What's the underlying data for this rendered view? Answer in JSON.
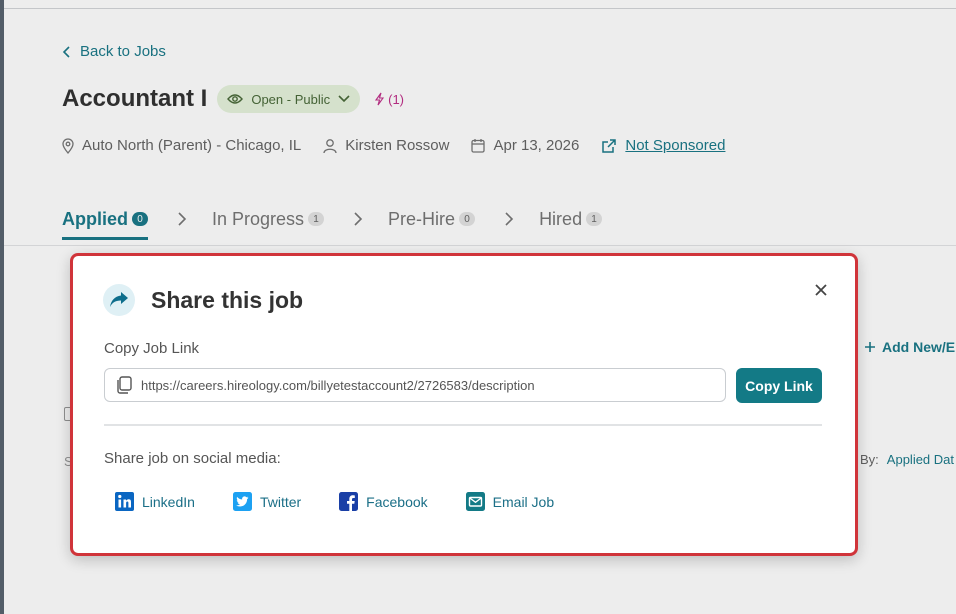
{
  "page": {
    "back_label": "Back to Jobs",
    "job_title": "Accountant I",
    "status": "Open - Public",
    "bolt_count": "(1)",
    "location": "Auto North (Parent) - Chicago, IL",
    "recruiter": "Kirsten Rossow",
    "date": "Apr 13, 2026",
    "sponsor_link": "Not Sponsored"
  },
  "tabs": [
    {
      "label": "Applied",
      "count": "0"
    },
    {
      "label": "In Progress",
      "count": "1"
    },
    {
      "label": "Pre-Hire",
      "count": "0"
    },
    {
      "label": "Hired",
      "count": "1"
    }
  ],
  "background": {
    "add_label": "Add New/E",
    "sort_label": "By:",
    "sort_value": "Applied Dat",
    "s_text": "S"
  },
  "modal": {
    "title": "Share this job",
    "copy_label": "Copy Job Link",
    "link_value": "https://careers.hireology.com/billyetestaccount2/2726583/description",
    "copy_button": "Copy Link",
    "social_label": "Share job on social media:",
    "socials": [
      {
        "label": "LinkedIn",
        "icon": "linkedin-icon"
      },
      {
        "label": "Twitter",
        "icon": "twitter-icon"
      },
      {
        "label": "Facebook",
        "icon": "facebook-icon"
      },
      {
        "label": "Email Job",
        "icon": "email-icon"
      }
    ]
  },
  "colors": {
    "accent": "#1b7a8a",
    "button": "#137a86",
    "modal_border": "#d0343a",
    "linkedin": "#0a66c2",
    "twitter": "#1da1f2",
    "facebook": "#1877f2"
  }
}
